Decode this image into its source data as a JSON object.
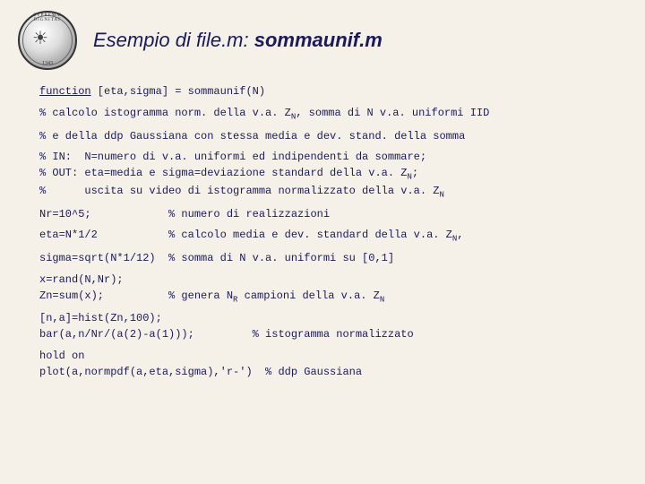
{
  "header": {
    "title_prefix": "Esempio di file.m: ",
    "title_bold": "sommaunif.m",
    "seal_top": "SVPREMÆ DIGNITAT",
    "seal_year": "1343"
  },
  "code": {
    "l1a": "function",
    "l1b": " [eta,sigma] = sommaunif(N)",
    "l2a": "% calcolo istogramma norm. della v.a. Z",
    "l2b": ", somma di N v.a. uniformi IID",
    "l3": "% e della ddp Gaussiana con stessa media e dev. stand. della somma",
    "l4": "% IN:  N=numero di v.a. uniformi ed indipendenti da sommare;",
    "l5a": "% OUT: eta=media e sigma=deviazione standard della v.a. Z",
    "l5b": ";",
    "l6a": "%      uscita su video di istogramma normalizzato della v.a. Z",
    "l7": "Nr=10^5;            % numero di realizzazioni",
    "l8a": "eta=N*1/2           % calcolo media e dev. standard della v.a. Z",
    "l8b": ",",
    "l9": "sigma=sqrt(N*1/12)  % somma di N v.a. uniformi su [0,1]",
    "l10": "x=rand(N,Nr);",
    "l11a": "Zn=sum(x);          % genera N",
    "l11b": " campioni della v.a. Z",
    "l12": "[n,a]=hist(Zn,100);",
    "l13": "bar(a,n/Nr/(a(2)-a(1)));         % istogramma normalizzato",
    "l14": "hold on",
    "l15": "plot(a,normpdf(a,eta,sigma),'r-')  % ddp Gaussiana",
    "subN": "N",
    "subR": "R"
  }
}
